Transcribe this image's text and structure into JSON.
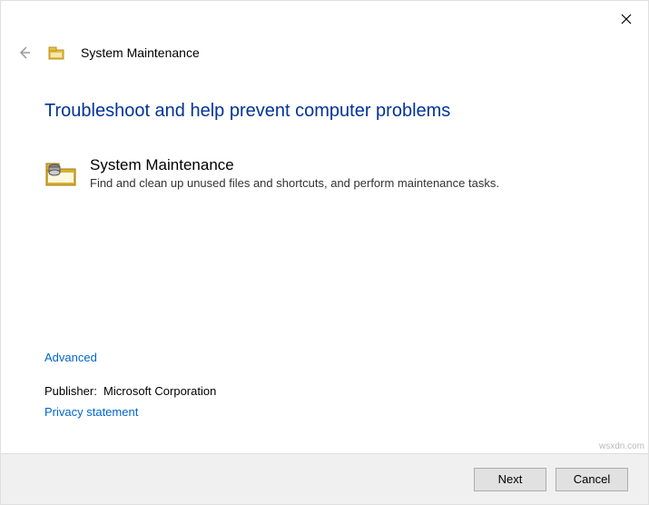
{
  "header": {
    "window_title": "System Maintenance"
  },
  "main": {
    "heading": "Troubleshoot and help prevent computer problems",
    "troubleshooter": {
      "title": "System Maintenance",
      "description": "Find and clean up unused files and shortcuts, and perform maintenance tasks."
    }
  },
  "links": {
    "advanced": "Advanced",
    "privacy": "Privacy statement"
  },
  "publisher": {
    "label": "Publisher:",
    "value": "Microsoft Corporation"
  },
  "footer": {
    "next": "Next",
    "cancel": "Cancel"
  },
  "watermark": "wsxdn.com"
}
